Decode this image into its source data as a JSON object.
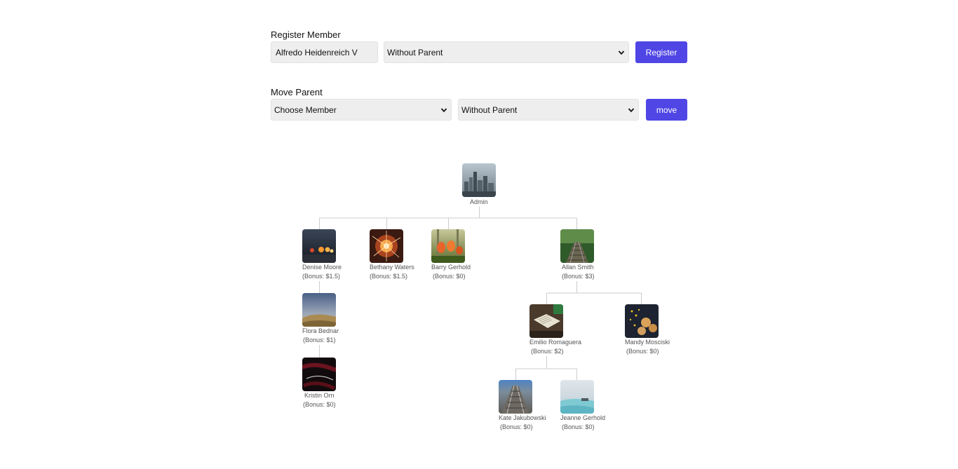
{
  "register": {
    "title": "Register Member",
    "name_value": "Alfredo Heidenreich V",
    "parent_selected": "Without Parent",
    "button_label": "Register"
  },
  "move": {
    "title": "Move Parent",
    "member_selected": "Choose Member",
    "parent_selected": "Without Parent",
    "button_label": "move"
  },
  "colors": {
    "accent": "#4f46e5",
    "field_bg": "#eeeeee",
    "line": "#cccccc"
  },
  "tree": {
    "admin": {
      "name": "Admin"
    },
    "denise": {
      "name": "Denise Moore",
      "bonus": "(Bonus: $1.5)"
    },
    "bethany": {
      "name": "Bethany Waters",
      "bonus": "(Bonus: $1.5)"
    },
    "barry": {
      "name": "Barry Gerhold",
      "bonus": "(Bonus: $0)"
    },
    "allan": {
      "name": "Allan Smith",
      "bonus": "(Bonus: $3)"
    },
    "flora": {
      "name": "Flora Bednar",
      "bonus": "(Bonus: $1)"
    },
    "kristin": {
      "name": "Kristin Orn",
      "bonus": "(Bonus: $0)"
    },
    "emilio": {
      "name": "Emilio Romaguera",
      "bonus": "(Bonus: $2)"
    },
    "mandy": {
      "name": "Mandy Mosciski",
      "bonus": "(Bonus: $0)"
    },
    "kate": {
      "name": "Kate Jakubowski",
      "bonus": "(Bonus: $0)"
    },
    "jeanne": {
      "name": "Jeanne Gerhold",
      "bonus": "(Bonus: $0)"
    }
  }
}
